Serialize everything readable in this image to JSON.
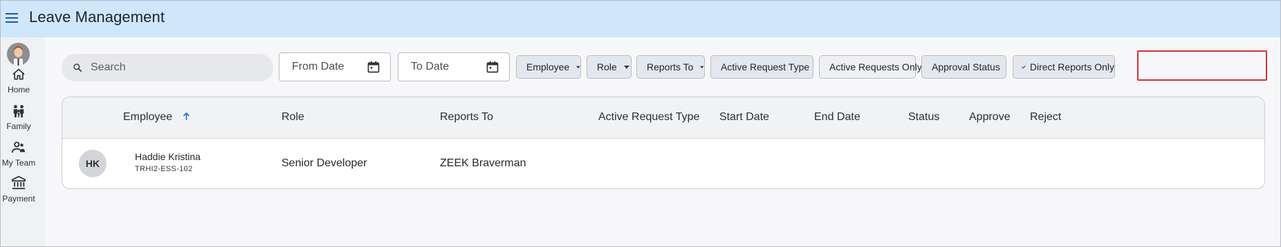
{
  "app": {
    "title": "Leave Management"
  },
  "sidebar": {
    "items": [
      {
        "label": "Home",
        "icon": "home-icon"
      },
      {
        "label": "Family",
        "icon": "family-icon"
      },
      {
        "label": "My Team",
        "icon": "team-icon"
      },
      {
        "label": "Payment",
        "icon": "bank-icon"
      }
    ]
  },
  "filters": {
    "search_placeholder": "Search",
    "from_date_placeholder": "From Date",
    "to_date_placeholder": "To Date",
    "chips": [
      {
        "label": "Employee",
        "dropdown": true
      },
      {
        "label": "Role",
        "dropdown": true
      },
      {
        "label": "Reports To",
        "dropdown": true
      },
      {
        "label": "Active Request Type",
        "dropdown": true
      },
      {
        "label": "Active Requests Only",
        "dropdown": false
      },
      {
        "label": "Approval Status",
        "dropdown": true
      },
      {
        "label": "Direct Reports Only",
        "dropdown": false,
        "selected": true
      }
    ]
  },
  "table": {
    "columns": [
      "Employee",
      "Role",
      "Reports To",
      "Active Request Type",
      "Start Date",
      "End Date",
      "Status",
      "Approve",
      "Reject"
    ],
    "sort": {
      "column": "Employee",
      "direction": "ascending"
    },
    "rows": [
      {
        "initials": "HK",
        "name": "Haddie Kristina",
        "employee_id": "TRHI2-ESS-102",
        "role": "Senior Developer",
        "reports_to": "ZEEK Braverman",
        "active_request_type": "",
        "start_date": "",
        "end_date": "",
        "status": ""
      }
    ]
  },
  "colors": {
    "topbar": "#cfe6fb",
    "accent": "#1a73c8",
    "highlight_border": "#d82f37"
  }
}
